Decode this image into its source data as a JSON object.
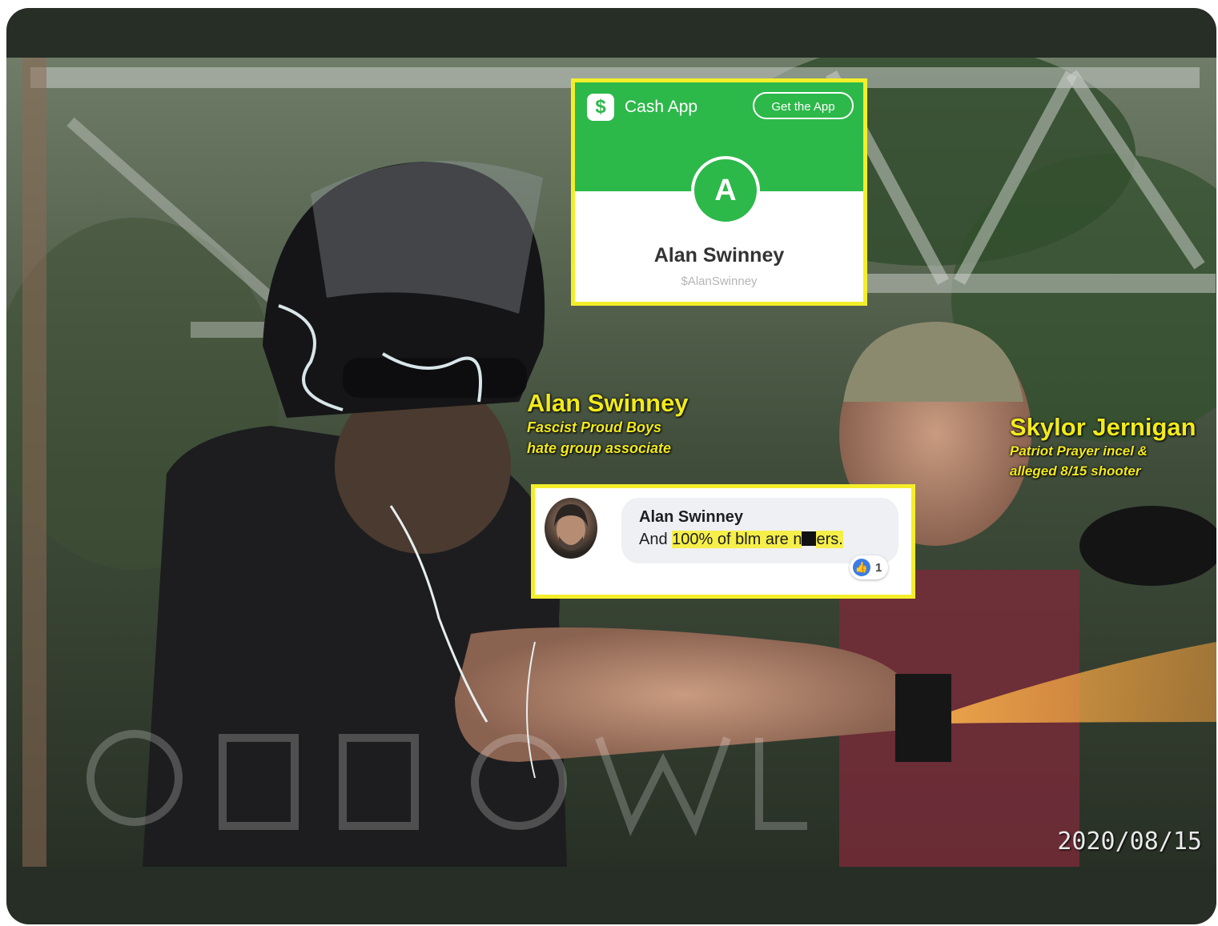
{
  "cashapp": {
    "logo_glyph": "$",
    "brand": "Cash App",
    "get_app_label": "Get the App",
    "avatar_letter": "A",
    "name": "Alan Swinney",
    "handle": "$AlanSwinney",
    "colors": {
      "green": "#2db84a",
      "border": "#f4ee2a"
    }
  },
  "labels": {
    "left_name": "Alan Swinney",
    "left_desc_line1": "Fascist Proud Boys",
    "left_desc_line2": "hate group associate",
    "right_name": "Skylor Jernigan",
    "right_desc_line1": "Patriot Prayer incel &",
    "right_desc_line2": "alleged 8/15 shooter",
    "color": "#f2ea1c"
  },
  "comment": {
    "author": "Alan Swinney",
    "text_prefix": "And ",
    "text_highlight_a": "100% of blm are n",
    "text_highlight_b": "ers.",
    "like_icon": "thumbs-up-icon",
    "like_count": "1"
  },
  "date_stamp": "2020/08/15"
}
